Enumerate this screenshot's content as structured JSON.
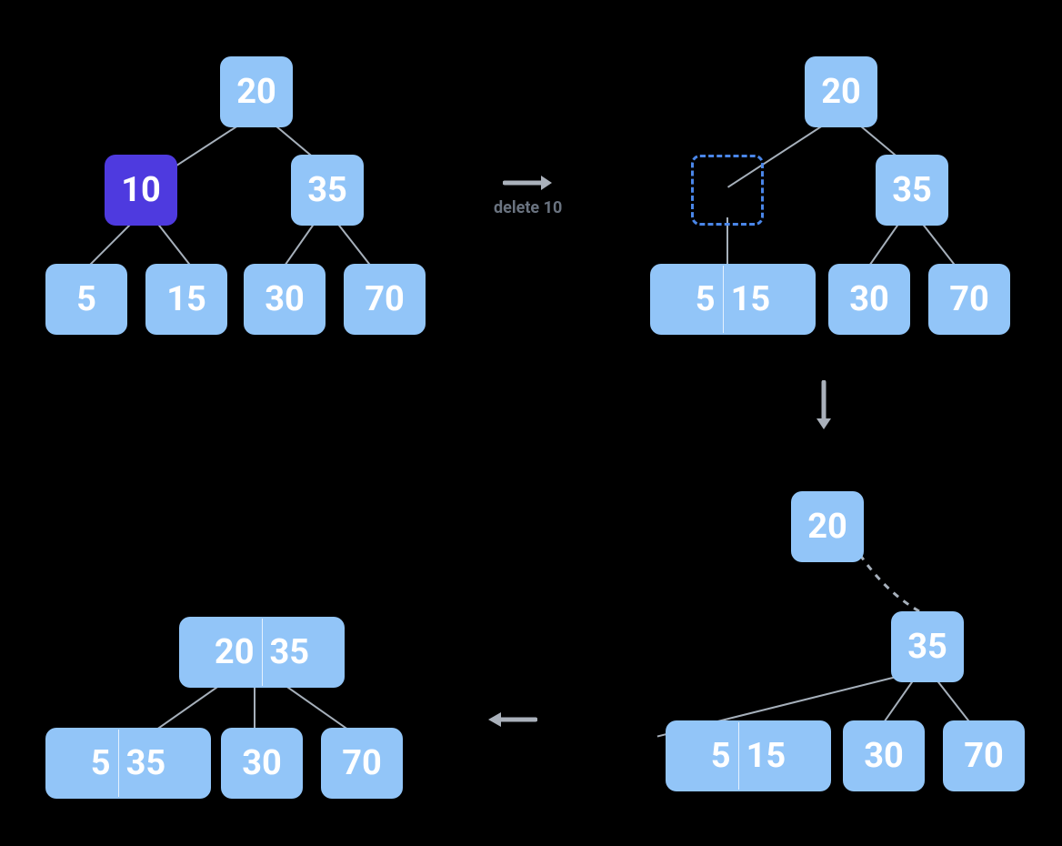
{
  "colors": {
    "node": "#92c5f8",
    "highlight": "#4e3adf",
    "edge": "#a6b0bb",
    "dash": "#4a86e8",
    "text": "#ffffff"
  },
  "steps": {
    "arrow1_label": "delete 10",
    "tree1": {
      "root": "20",
      "left": "10",
      "right": "35",
      "leaves": {
        "ll": "5",
        "lr": "15",
        "rl": "30",
        "rr": "70"
      }
    },
    "tree2": {
      "root": "20",
      "left_removed": true,
      "right": "35",
      "left_leaf_merged": {
        "a": "5",
        "b": "15"
      },
      "right_leaves": {
        "rl": "30",
        "rr": "70"
      }
    },
    "tree3": {
      "root": "20",
      "right": "35",
      "left_leaf_merged": {
        "a": "5",
        "b": "15"
      },
      "right_leaves": {
        "rl": "30",
        "rr": "70"
      }
    },
    "tree4": {
      "root_merged": {
        "a": "20",
        "b": "35"
      },
      "leaves": {
        "left_merged": {
          "a": "5",
          "b": "35"
        },
        "mid": "30",
        "right": "70"
      }
    }
  }
}
